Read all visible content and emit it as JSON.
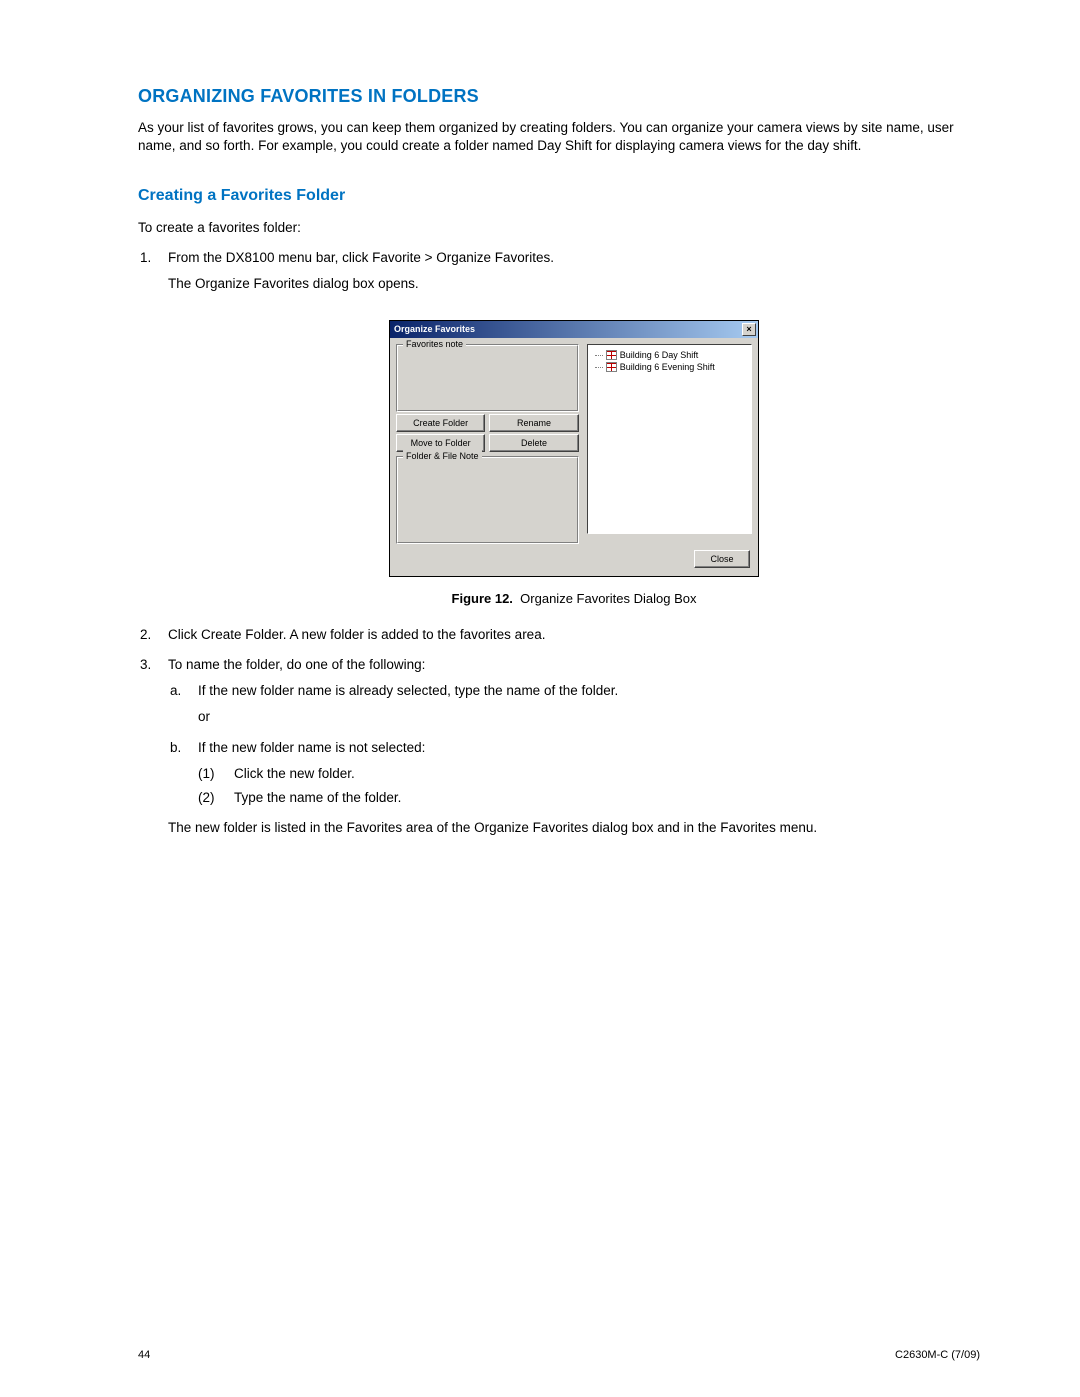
{
  "headings": {
    "h1": "ORGANIZING FAVORITES IN FOLDERS",
    "h2": "Creating a Favorites Folder"
  },
  "intro": "As your list of favorites grows, you can keep them organized by creating folders. You can organize your camera views by site name, user name, and so forth. For example, you could create a folder named Day Shift for displaying camera views for the day shift.",
  "lead": "To create a favorites folder:",
  "steps": {
    "s1a": "From the DX8100 menu bar, click Favorite > Organize Favorites.",
    "s1b": "The Organize Favorites dialog box opens.",
    "s2": "Click Create Folder. A new folder is added to the favorites area.",
    "s3": "To name the folder, do one of the following:",
    "s3a": "If the new folder name is already selected, type the name of the folder.",
    "or": "or",
    "s3b": "If the new folder name is not selected:",
    "s3b1": "Click the new folder.",
    "s3b2": "Type the name of the folder.",
    "final": "The new folder is listed in the Favorites area of the Organize Favorites dialog box and in the Favorites menu."
  },
  "dialog": {
    "title": "Organize Favorites",
    "favnote": "Favorites note",
    "folderfile": "Folder & File Note",
    "buttons": {
      "create": "Create Folder",
      "rename": "Rename",
      "move": "Move to Folder",
      "delete": "Delete",
      "close": "Close"
    },
    "tree": {
      "i1": "Building 6 Day Shift",
      "i2": "Building 6 Evening Shift"
    }
  },
  "figure": {
    "label": "Figure 12.",
    "caption": "Organize Favorites Dialog Box"
  },
  "footer": {
    "page": "44",
    "doc": "C2630M-C (7/09)"
  }
}
